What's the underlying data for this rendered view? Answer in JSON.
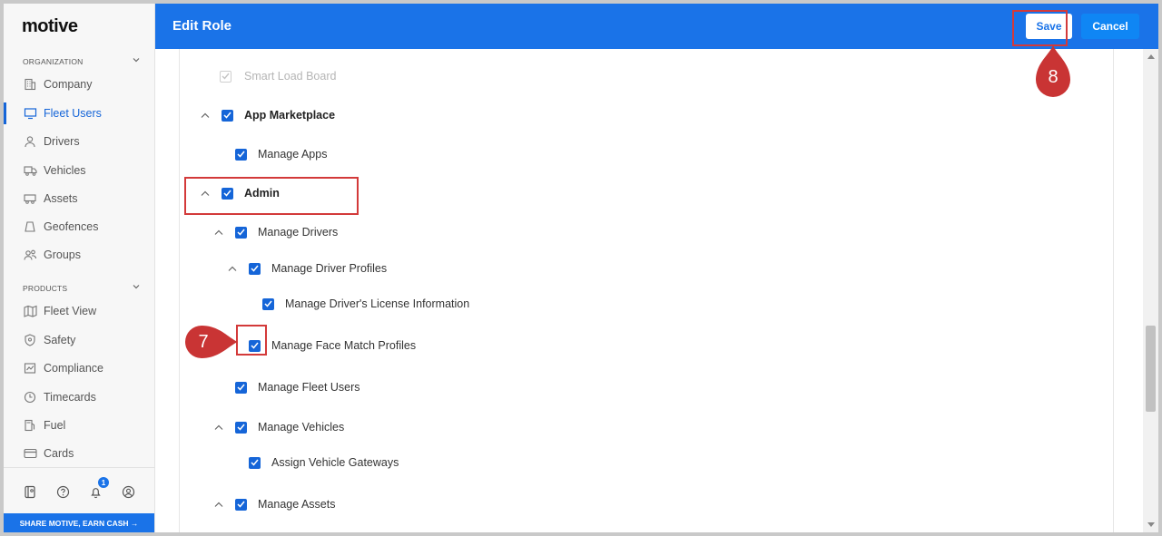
{
  "logo": "motive",
  "sidebar": {
    "sections": [
      {
        "label": "ORGANIZATION"
      },
      {
        "label": "PRODUCTS"
      }
    ],
    "org_items": [
      {
        "label": "Company",
        "icon": "building-icon"
      },
      {
        "label": "Fleet Users",
        "icon": "monitor-icon",
        "active": true
      },
      {
        "label": "Drivers",
        "icon": "person-icon"
      },
      {
        "label": "Vehicles",
        "icon": "truck-icon"
      },
      {
        "label": "Assets",
        "icon": "trailer-icon"
      },
      {
        "label": "Geofences",
        "icon": "geofence-icon"
      },
      {
        "label": "Groups",
        "icon": "people-icon"
      }
    ],
    "product_items": [
      {
        "label": "Fleet View",
        "icon": "map-icon"
      },
      {
        "label": "Safety",
        "icon": "shield-icon"
      },
      {
        "label": "Compliance",
        "icon": "chart-icon"
      },
      {
        "label": "Timecards",
        "icon": "clock-icon"
      },
      {
        "label": "Fuel",
        "icon": "fuel-icon"
      },
      {
        "label": "Cards",
        "icon": "card-icon"
      }
    ],
    "notification_count": "1",
    "share_label": "SHARE MOTIVE, EARN CASH →"
  },
  "header": {
    "title": "Edit Role",
    "save_label": "Save",
    "cancel_label": "Cancel"
  },
  "permissions": [
    {
      "label": "Smart Load Board",
      "checked": true,
      "disabled": true
    },
    {
      "label": "App Marketplace",
      "checked": true,
      "bold": true,
      "expanded": true
    },
    {
      "label": "Manage Apps",
      "checked": true
    },
    {
      "label": "Admin",
      "checked": true,
      "bold": true,
      "expanded": true
    },
    {
      "label": "Manage Drivers",
      "checked": true,
      "expanded": true
    },
    {
      "label": "Manage Driver Profiles",
      "checked": true,
      "expanded": true
    },
    {
      "label": "Manage Driver's License Information",
      "checked": true
    },
    {
      "label": "Manage Face Match Profiles",
      "checked": true
    },
    {
      "label": "Manage Fleet Users",
      "checked": true
    },
    {
      "label": "Manage Vehicles",
      "checked": true,
      "expanded": true
    },
    {
      "label": "Assign Vehicle Gateways",
      "checked": true
    },
    {
      "label": "Manage Assets",
      "checked": true,
      "expanded": true
    }
  ],
  "annotations": {
    "step7": "7",
    "step8": "8"
  },
  "colors": {
    "brand_blue": "#1a73e8",
    "checkbox_blue": "#1565d8",
    "annotation_red": "#c93434"
  }
}
